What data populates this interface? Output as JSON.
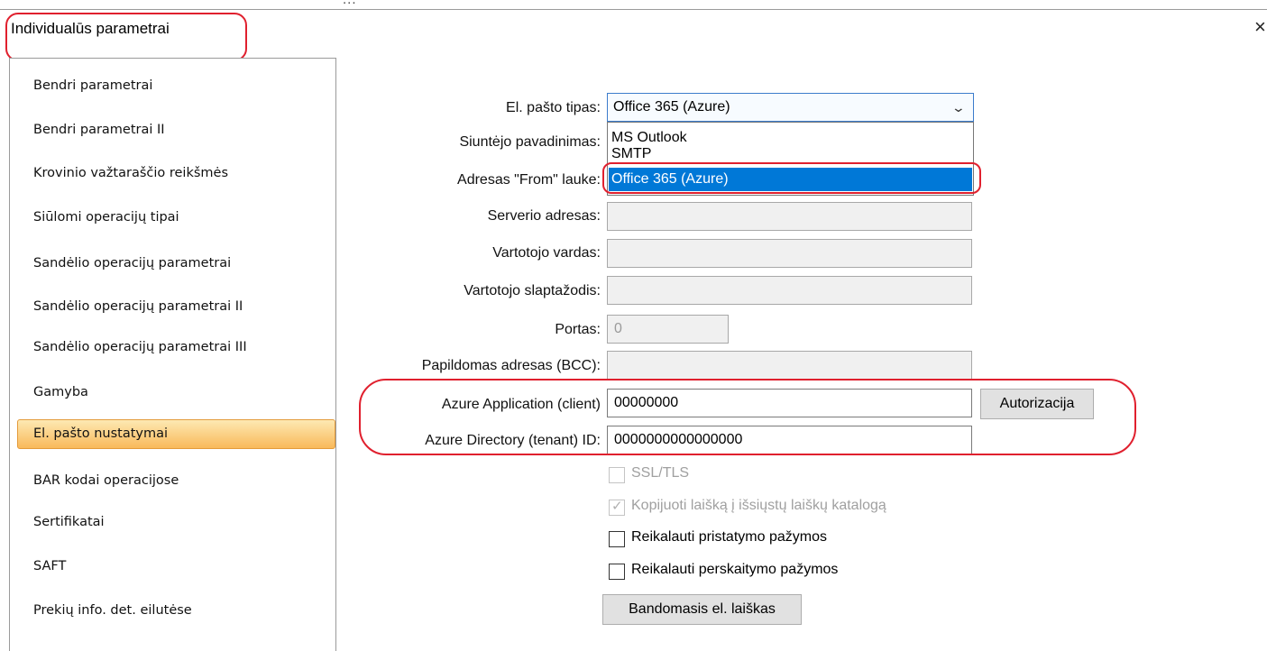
{
  "window": {
    "title": "Individualūs parametrai",
    "close_glyph": "×",
    "top_cut_text": "..."
  },
  "sidebar": {
    "items": [
      {
        "label": "Bendri parametrai"
      },
      {
        "label": "Bendri parametrai II"
      },
      {
        "label": "Krovinio važtaraščio reikšmės"
      },
      {
        "label": "Siūlomi operacijų tipai"
      },
      {
        "label": "Sandėlio operacijų parametrai"
      },
      {
        "label": "Sandėlio operacijų parametrai II"
      },
      {
        "label": "Sandėlio operacijų parametrai III"
      },
      {
        "label": "Gamyba"
      },
      {
        "label": "El. pašto nustatymai",
        "selected": true
      },
      {
        "label": "BAR kodai operacijose"
      },
      {
        "label": "Sertifikatai"
      },
      {
        "label": "SAFT"
      },
      {
        "label": "Prekių info. det. eilutėse"
      }
    ]
  },
  "form": {
    "email_type": {
      "label": "El. pašto tipas:",
      "value": "Office 365 (Azure)",
      "options": [
        "MS Outlook",
        "SMTP",
        "Office 365 (Azure)"
      ],
      "selected_option": "Office 365 (Azure)"
    },
    "sender_name": {
      "label": "Siuntėjo pavadinimas:",
      "value": ""
    },
    "from_address": {
      "label": "Adresas \"From\" lauke:",
      "value": ""
    },
    "server_address": {
      "label": "Serverio adresas:",
      "value": ""
    },
    "username": {
      "label": "Vartotojo vardas:",
      "value": ""
    },
    "password": {
      "label": "Vartotojo slaptažodis:",
      "value": ""
    },
    "port": {
      "label": "Portas:",
      "value": "0"
    },
    "bcc": {
      "label": "Papildomas adresas (BCC):",
      "value": ""
    },
    "azure_app": {
      "label": "Azure Application (client)",
      "value": "00000000"
    },
    "azure_tenant": {
      "label": "Azure Directory (tenant) ID:",
      "value": "0000000000000000"
    },
    "authorize_button": "Autorizacija",
    "checkboxes": {
      "ssl": {
        "label": "SSL/TLS",
        "checked": false,
        "disabled": true
      },
      "copy_sent": {
        "label": "Kopijuoti laišką į išsiųstų laiškų katalogą",
        "checked": true,
        "disabled": true
      },
      "delivery_receipt": {
        "label": "Reikalauti pristatymo pažymos",
        "checked": false,
        "disabled": false
      },
      "read_receipt": {
        "label": "Reikalauti perskaitymo pažymos",
        "checked": false,
        "disabled": false
      }
    },
    "test_email_button": "Bandomasis el. laiškas"
  },
  "colors": {
    "annotation_red": "#e0202e",
    "selection_blue": "#0078d7",
    "active_item_orange": "#f9b95a"
  },
  "icons": {
    "close": "close-icon",
    "dropdown": "chevron-down-icon",
    "check": "checkmark-icon"
  }
}
